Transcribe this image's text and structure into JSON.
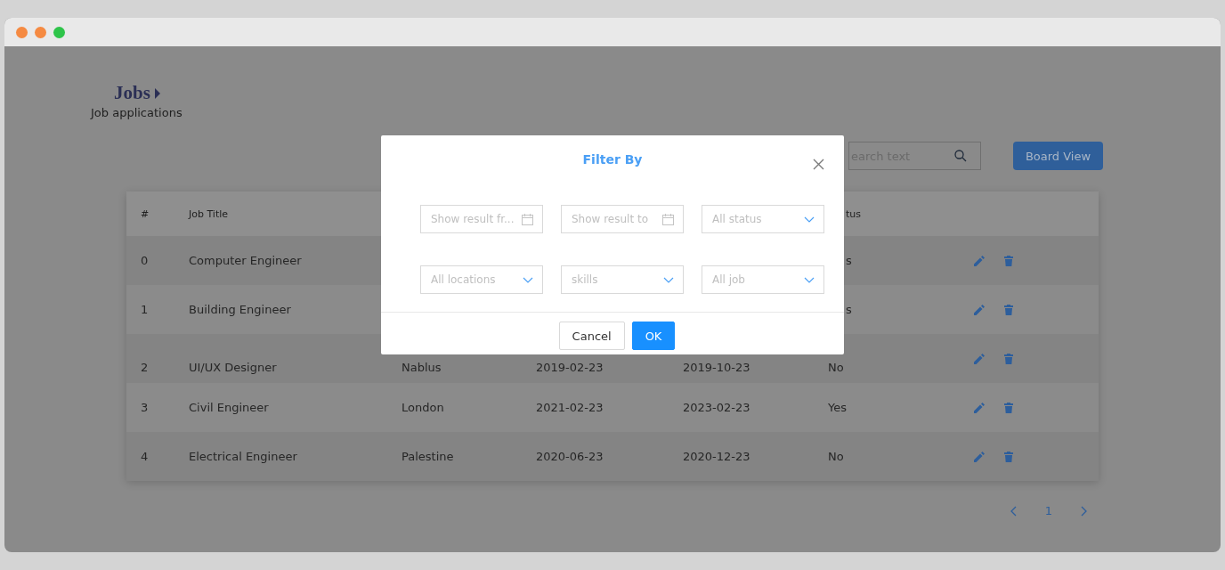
{
  "page": {
    "title": "Jobs",
    "subtitle": "Job applications"
  },
  "toolbar": {
    "search_placeholder": "earch text",
    "board_button": "Board View"
  },
  "table": {
    "columns": {
      "index": "#",
      "title": "Job Title",
      "status": "tus"
    },
    "rows": [
      {
        "index": "0",
        "title": "Computer Engineer",
        "status": "s"
      },
      {
        "index": "1",
        "title": "Building Engineer",
        "status": "s"
      },
      {
        "index": "2",
        "title": "UI/UX Designer",
        "location": "Nablus",
        "start": "2019-02-23",
        "end": "2019-10-23",
        "status": "No"
      },
      {
        "index": "3",
        "title": "Civil Engineer",
        "location": "London",
        "start": "2021-02-23",
        "end": "2023-02-23",
        "status": "Yes"
      },
      {
        "index": "4",
        "title": "Electrical Engineer",
        "location": "Palestine",
        "start": "2020-06-23",
        "end": "2020-12-23",
        "status": "No"
      }
    ]
  },
  "pagination": {
    "pages": [
      {
        "label": "1",
        "selected": true
      }
    ]
  },
  "dialog": {
    "title": "Filter By",
    "fields": [
      {
        "kind": "date",
        "placeholder": "Show result fr..."
      },
      {
        "kind": "date",
        "placeholder": "Show result to"
      },
      {
        "kind": "select",
        "placeholder": "All status"
      },
      {
        "kind": "select",
        "placeholder": "All locations"
      },
      {
        "kind": "select",
        "placeholder": "skills"
      },
      {
        "kind": "select",
        "placeholder": "All job"
      }
    ],
    "buttons": [
      {
        "label": "Cancel",
        "kind": "default"
      },
      {
        "label": "OK",
        "kind": "primary"
      }
    ]
  }
}
